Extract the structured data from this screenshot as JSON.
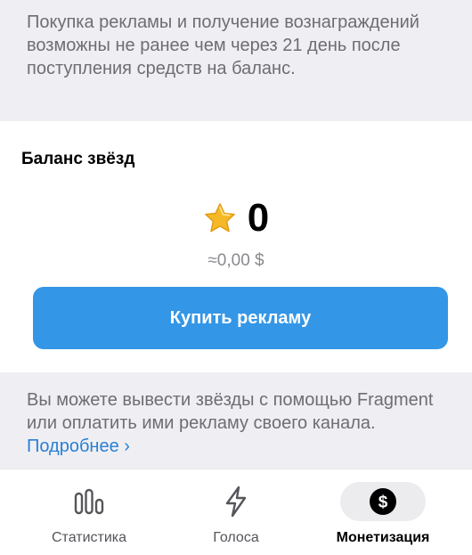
{
  "notice_top": {
    "text": "Покупка рекламы и получение вознаграждений возможны не ранее чем через 21 день после поступления средств на баланс."
  },
  "balance": {
    "title": "Баланс звёзд",
    "stars": "0",
    "usd": "≈0,00 $",
    "star_icon": "star-icon"
  },
  "buy_button": {
    "label": "Купить рекламу"
  },
  "notice_bottom": {
    "text": "Вы можете вывести звёзды с помощью Fragment или оплатить ими рекламу своего канала. ",
    "link": "Подробнее ›"
  },
  "tabbar": {
    "tabs": [
      {
        "label": "Статистика",
        "icon": "bar-chart-icon",
        "active": false
      },
      {
        "label": "Голоса",
        "icon": "lightning-icon",
        "active": false
      },
      {
        "label": "Монетизация",
        "icon": "dollar-coin-icon",
        "active": true
      }
    ]
  },
  "colors": {
    "accent": "#3496e6",
    "link": "#2a7fd4",
    "star": "#f5b826",
    "section_bg": "#efeff3"
  }
}
